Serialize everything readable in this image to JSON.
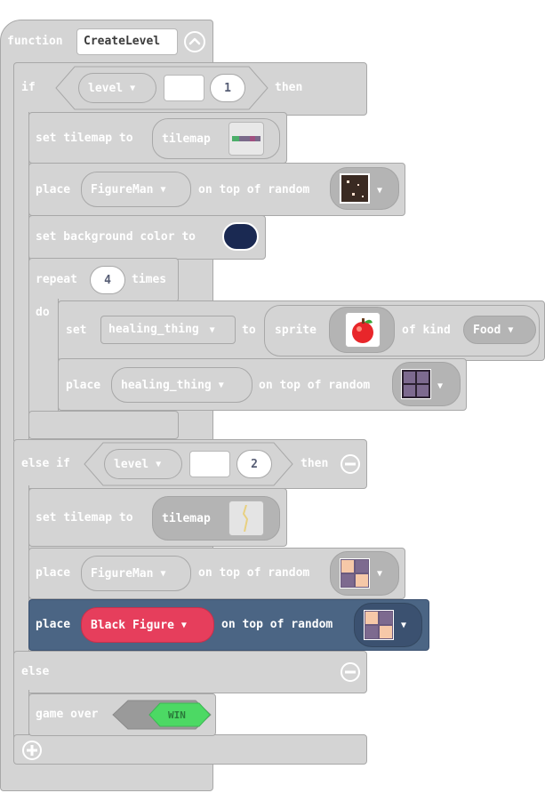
{
  "colors": {
    "block": "#d4d4d4",
    "block_border": "#a8a8a8",
    "highlight": "#4b6584",
    "red": "#e63e5c",
    "win": "#4cd964",
    "navy": "#1a2952"
  },
  "function_block": {
    "keyword": "function",
    "name": "CreateLevel"
  },
  "if_branch": {
    "keyword": "if",
    "then": "then",
    "condition": {
      "variable": "level",
      "operator": "=",
      "value": "1"
    },
    "set_tilemap": {
      "label": "set tilemap to",
      "value": "tilemap"
    },
    "place_figure": {
      "label": "place",
      "sprite": "FigureMan",
      "on_top": "on top of random"
    },
    "set_bg": {
      "label": "set background color to"
    },
    "repeat": {
      "label": "repeat",
      "count": "4",
      "times": "times",
      "do": "do",
      "set_sprite": {
        "label": "set",
        "variable": "healing_thing",
        "to": "to",
        "sprite": "sprite",
        "of_kind": "of kind",
        "kind": "Food"
      },
      "place": {
        "label": "place",
        "variable": "healing_thing",
        "on_top": "on top of random"
      }
    }
  },
  "else_if_branch": {
    "keyword": "else if",
    "then": "then",
    "condition": {
      "variable": "level",
      "operator": "=",
      "value": "2"
    },
    "set_tilemap": {
      "label": "set tilemap to",
      "value": "tilemap"
    },
    "place_figure": {
      "label": "place",
      "sprite": "FigureMan",
      "on_top": "on top of random"
    },
    "place_black": {
      "label": "place",
      "sprite": "Black Figure",
      "on_top": "on top of random"
    }
  },
  "else_branch": {
    "keyword": "else",
    "game_over": "game over",
    "result": "WIN"
  }
}
